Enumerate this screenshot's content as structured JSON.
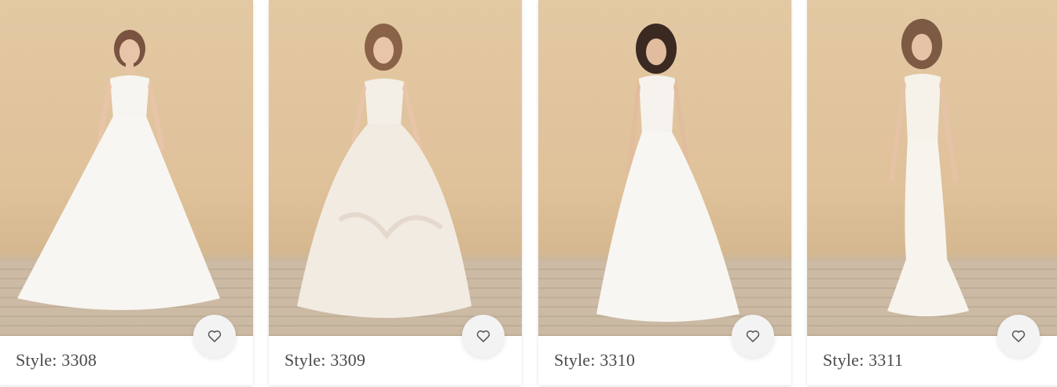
{
  "products": [
    {
      "style_label": "Style: 3308",
      "favorite_icon": "heart-outline-icon"
    },
    {
      "style_label": "Style: 3309",
      "favorite_icon": "heart-outline-icon"
    },
    {
      "style_label": "Style: 3310",
      "favorite_icon": "heart-outline-icon"
    },
    {
      "style_label": "Style: 3311",
      "favorite_icon": "heart-outline-icon"
    }
  ],
  "colors": {
    "backdrop": "#e3c9a3",
    "floor": "#c9b7a0",
    "dress": "#f8f6f2",
    "card_bg": "#ffffff",
    "fav_bg": "#f3f3f4",
    "text": "#4a4a4a",
    "icon": "#555555"
  }
}
